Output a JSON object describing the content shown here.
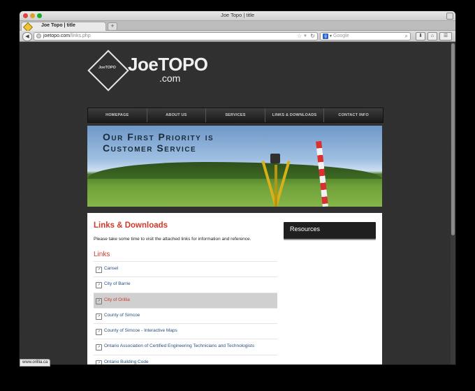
{
  "browser": {
    "window_title": "Joe Topo | title",
    "tab_title": "Joe Topo | title",
    "new_tab_label": "+",
    "url_domain": "joetopo.com",
    "url_path": "/links.php",
    "search_placeholder": "Google",
    "status_url": "www.orillia.ca",
    "icons": [
      "back-icon",
      "site-identity-icon",
      "bookmark-star-icon",
      "history-dropdown-icon",
      "reload-icon",
      "search-engine-icon",
      "search-go-icon",
      "download-icon",
      "home-icon",
      "menu-icon"
    ]
  },
  "site": {
    "logo_badge": "JoeTOPO",
    "logo_name": "JoeTOPO",
    "logo_domain": ".com",
    "menu": [
      "HOMEPAGE",
      "ABOUT US",
      "SERVICES",
      "LINKS & DOWNLOADS",
      "CONTACT INFO"
    ],
    "banner_line1": "Our First Priority is",
    "banner_line2": "Customer Service"
  },
  "content": {
    "heading": "Links & Downloads",
    "intro": "Please take some time to visit the attached links for information and reference.",
    "links_heading": "Links",
    "links": [
      {
        "label": "Cansel",
        "active": false
      },
      {
        "label": "City of Barrie",
        "active": false
      },
      {
        "label": "City of Orillia",
        "active": true
      },
      {
        "label": "County of Simcoe",
        "active": false
      },
      {
        "label": "County of Simcoe - Interactive Maps",
        "active": false
      },
      {
        "label": "Ontario Association of Certified Engineering Technicians and Technologists",
        "active": false
      },
      {
        "label": "Ontario Building Code",
        "active": false
      }
    ],
    "sidebar_title": "Resources"
  },
  "colors": {
    "accent": "#cf3a2a",
    "link": "#2a4f7a",
    "menu_bg": "#262626",
    "active_row": "#d0d0d0"
  }
}
